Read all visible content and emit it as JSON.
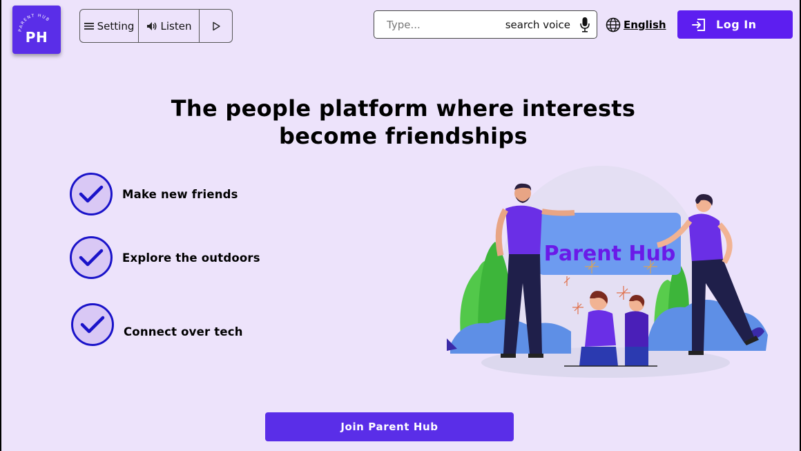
{
  "logo": {
    "text": "PH",
    "ring_text": "PARENT HUB",
    "icon": "logo-icon"
  },
  "toolbar": {
    "setting_label": "Setting",
    "listen_label": "Listen",
    "setting_icon": "hamburger-icon",
    "listen_icon": "speaker-icon",
    "play_icon": "play-icon"
  },
  "search": {
    "placeholder": "Type...",
    "voice_label": "search voice",
    "mic_icon": "microphone-icon"
  },
  "language": {
    "label": "English",
    "icon": "globe-icon"
  },
  "login": {
    "label": "Log In",
    "icon": "login-icon"
  },
  "headline": {
    "line1": "The people platform where interests",
    "line2": "become friendships"
  },
  "features": [
    {
      "label": "Make new friends",
      "icon": "check-icon"
    },
    {
      "label": "Explore the outdoors",
      "icon": "check-icon"
    },
    {
      "label": "Connect over tech",
      "icon": "check-icon"
    }
  ],
  "illustration": {
    "sign_text": "Parent Hub"
  },
  "cta": {
    "label": "Join Parent Hub"
  },
  "colors": {
    "background": "#ede3fb",
    "primary": "#5a2ee8",
    "login": "#5d1ef0",
    "check": "#1a13c9",
    "sign_text": "#6a1ae8"
  }
}
